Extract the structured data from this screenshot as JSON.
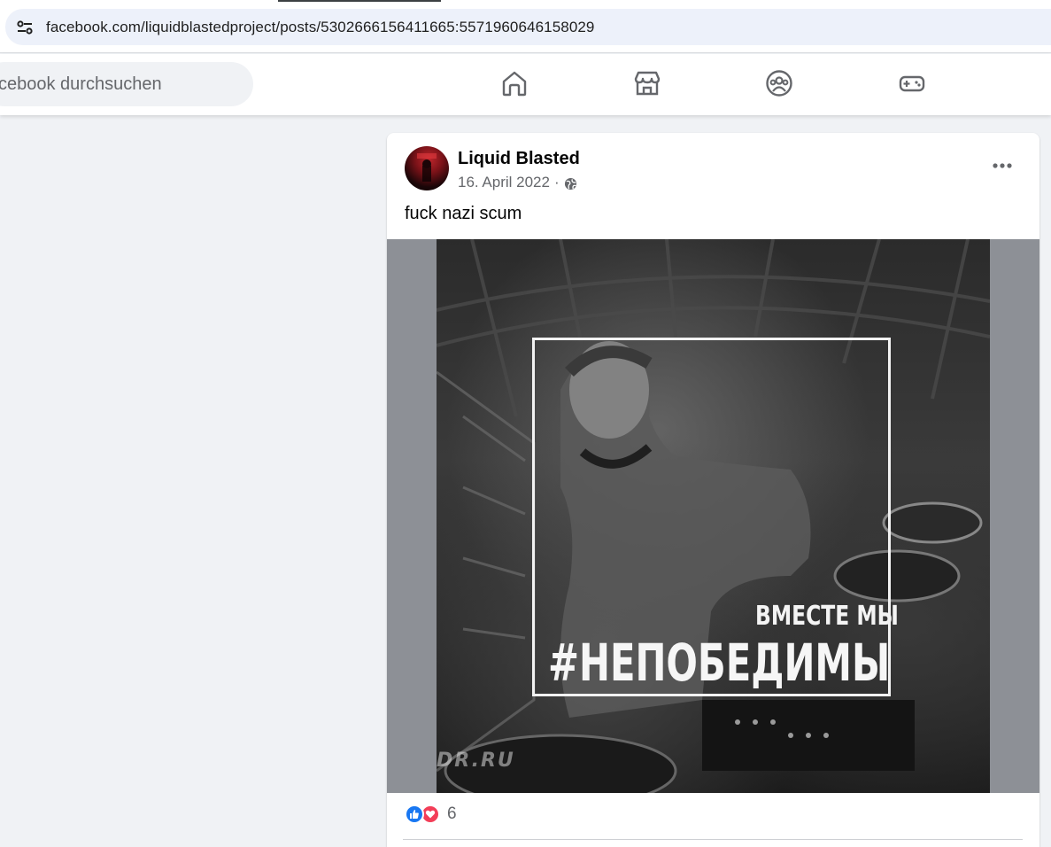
{
  "browser": {
    "url": "facebook.com/liquidblastedproject/posts/5302666156411665:5571960646158029",
    "site_info_icon": "tune-icon"
  },
  "nav": {
    "search_placeholder": "cebook durchsuchen",
    "icons": [
      "home-icon",
      "marketplace-icon",
      "groups-icon",
      "gaming-icon"
    ]
  },
  "post": {
    "author": "Liquid Blasted",
    "date": "16. April 2022",
    "separator": "·",
    "audience_icon": "globe-icon",
    "text": "fuck nazi scum",
    "image": {
      "overlay_subtitle": "ВМЕСТЕ МЫ",
      "overlay_title": "#НЕПОБЕДИМЫ",
      "watermark": "DR.RU"
    },
    "reactions": {
      "types": [
        "like",
        "love"
      ],
      "count": "6"
    }
  },
  "colors": {
    "fb_blue": "#1877f2",
    "love_red": "#f33e58",
    "page_bg": "#f0f2f5"
  }
}
